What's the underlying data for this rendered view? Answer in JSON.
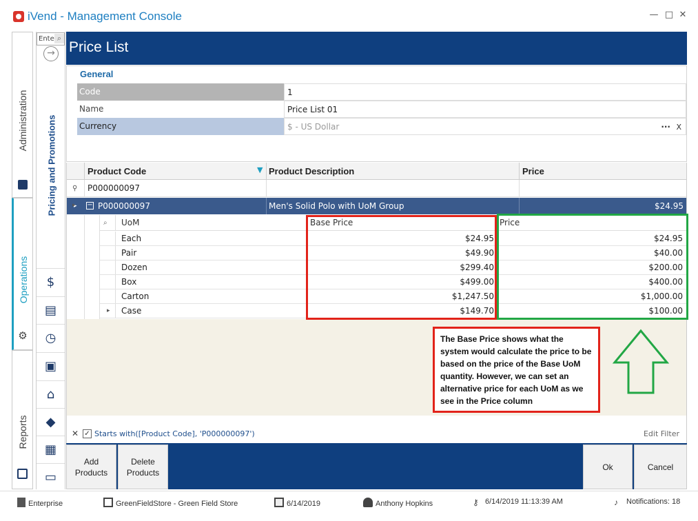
{
  "window": {
    "title": "iVend - Management Console",
    "controls": {
      "minimize": "—",
      "maximize": "□",
      "close": "✕"
    }
  },
  "modules": [
    {
      "label": "Administration",
      "icon": "id-card-icon"
    },
    {
      "label": "Operations",
      "icon": "gear-icon",
      "active": true
    },
    {
      "label": "Reports",
      "icon": "report-icon"
    }
  ],
  "nav": {
    "search_placeholder": "Ente",
    "section_label": "Pricing and Promotions",
    "icons": [
      "price-tag-money-icon",
      "cash-register-icon",
      "clock-icon",
      "gift-icon",
      "store-icon",
      "tag-icon",
      "warehouse-icon",
      "gift-card-icon"
    ]
  },
  "page": {
    "title": "Price List",
    "general": {
      "title": "General",
      "fields": [
        {
          "label": "Code",
          "value": "1"
        },
        {
          "label": "Name",
          "value": "Price List 01"
        },
        {
          "label": "Currency",
          "value": "$ - US Dollar"
        }
      ],
      "currency_more": "···",
      "currency_clear": "X"
    },
    "grid": {
      "columns": [
        "Product Code",
        "Product Description",
        "Price"
      ],
      "filter_row": {
        "product_code": "P000000097"
      },
      "main_row": {
        "product_code": "P000000097",
        "description": "Men's Solid Polo with UoM Group",
        "price": "$24.95"
      },
      "detail": {
        "columns": [
          "UoM",
          "Base Price",
          "Price"
        ],
        "rows": [
          {
            "uom": "Each",
            "base_price": "$24.95",
            "price": "$24.95"
          },
          {
            "uom": "Pair",
            "base_price": "$49.90",
            "price": "$40.00"
          },
          {
            "uom": "Dozen",
            "base_price": "$299.40",
            "price": "$200.00"
          },
          {
            "uom": "Box",
            "base_price": "$499.00",
            "price": "$400.00"
          },
          {
            "uom": "Carton",
            "base_price": "$1,247.50",
            "price": "$1,000.00"
          },
          {
            "uom": "Case",
            "base_price": "$149.70",
            "price": "$100.00"
          }
        ]
      }
    },
    "annotation": "The Base Price shows what the system would calculate the price to be based on the price of the Base UoM quantity. However, we can set an alternative price for each UoM as we see in the Price column",
    "filter": {
      "text": "Starts with([Product Code], 'P000000097')",
      "edit_label": "Edit Filter"
    },
    "actions": {
      "add": "Add Products",
      "delete": "Delete Products",
      "ok": "Ok",
      "cancel": "Cancel"
    }
  },
  "status": {
    "level": "Enterprise",
    "store": "GreenFieldStore - Green Field Store",
    "date": "6/14/2019",
    "user": "Anthony Hopkins",
    "login_time": "6/14/2019 11:13:39 AM",
    "notifications": "Notifications: 18"
  },
  "colors": {
    "header": "#0f3f7f",
    "accent": "#1e7fc1",
    "row_selected": "#3a5a8c",
    "highlight_red": "#e2231a",
    "highlight_green": "#22a745"
  }
}
